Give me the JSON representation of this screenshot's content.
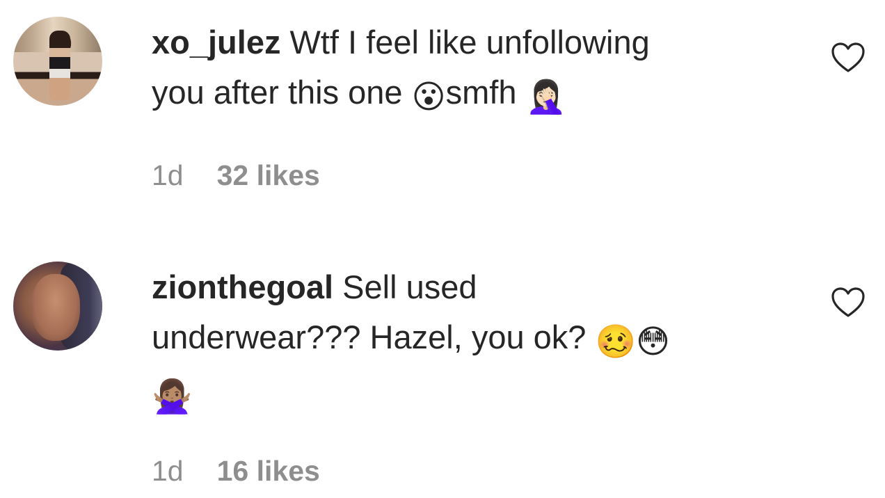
{
  "comments": [
    {
      "username": "xo_julez",
      "text_line1": " Wtf I feel like unfollowing",
      "text_line2": "you after this one ",
      "emoji1": "😮",
      "text_after_emoji1": "smfh ",
      "emoji2": "🤦🏻‍♀️",
      "time": "1d",
      "likes": "32 likes",
      "like_icon": "heart-outline-icon"
    },
    {
      "username": "zionthegoal",
      "text_line1": " Sell used",
      "text_line2": "underwear??? Hazel, you ok? ",
      "emoji1": "🥴",
      "emoji2": "😳",
      "emoji3": "🙅🏽‍♀️",
      "time": "1d",
      "likes": "16 likes",
      "like_icon": "heart-outline-icon"
    }
  ],
  "colors": {
    "text": "#262626",
    "meta": "#8e8e8e",
    "background": "#ffffff"
  }
}
